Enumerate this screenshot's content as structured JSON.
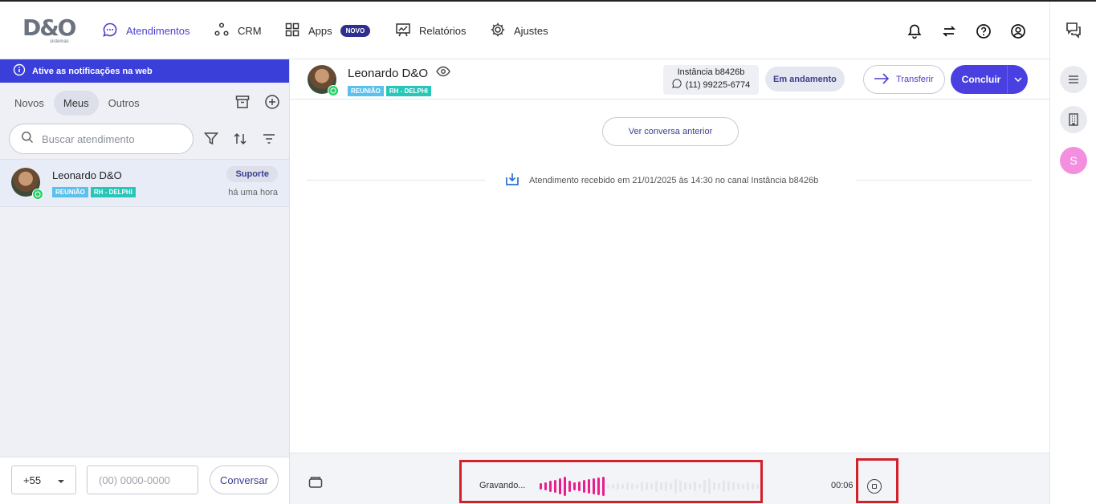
{
  "app": {
    "logo_text": "D&O",
    "logo_sub": "sistemas"
  },
  "nav": {
    "items": [
      {
        "label": "Atendimentos",
        "icon": "chat-bubble-icon",
        "active": true
      },
      {
        "label": "CRM",
        "icon": "nodes-icon"
      },
      {
        "label": "Apps",
        "icon": "grid-icon",
        "badge": "NOVO"
      },
      {
        "label": "Relatórios",
        "icon": "chart-board-icon"
      },
      {
        "label": "Ajustes",
        "icon": "gear-icon"
      }
    ],
    "right_icons": [
      "bell-icon",
      "swap-arrows-icon",
      "help-circle-icon",
      "user-circle-icon"
    ]
  },
  "rail": {
    "icons": [
      "chat-bubbles-icon",
      "menu-icon",
      "building-icon"
    ],
    "avatar_letter": "S"
  },
  "sidebar": {
    "notification": "Ative as notificações na web",
    "tabs": [
      {
        "label": "Novos"
      },
      {
        "label": "Meus",
        "active": true
      },
      {
        "label": "Outros"
      }
    ],
    "search_placeholder": "Buscar atendimento",
    "conversations": [
      {
        "name": "Leonardo D&O",
        "tags": [
          "REUNIÃO",
          "RH - DELPHI"
        ],
        "queue": "Suporte",
        "time": "há uma hora"
      }
    ],
    "footer": {
      "ddi": "+55",
      "phone_placeholder": "(00) 0000-0000",
      "button": "Conversar"
    }
  },
  "chat": {
    "contact_name": "Leonardo D&O",
    "tags": [
      "REUNIÃO",
      "RH - DELPHI"
    ],
    "instance_label": "Instância b8426b",
    "instance_phone": "(11) 99225-6774",
    "status": "Em andamento",
    "transfer_label": "Transferir",
    "conclude_label": "Concluir",
    "previous_label": "Ver conversa anterior",
    "received_text": "Atendimento recebido em 21/01/2025 às 14:30 no canal Instância b8426b"
  },
  "recording": {
    "label": "Gravando...",
    "timer": "00:06",
    "wave_color": "#e91e8c",
    "highlight_color": "#d3212a"
  },
  "colors": {
    "accent": "#4a3fe0",
    "notify_bar": "#3a3fd9",
    "whatsapp": "#25d366"
  }
}
